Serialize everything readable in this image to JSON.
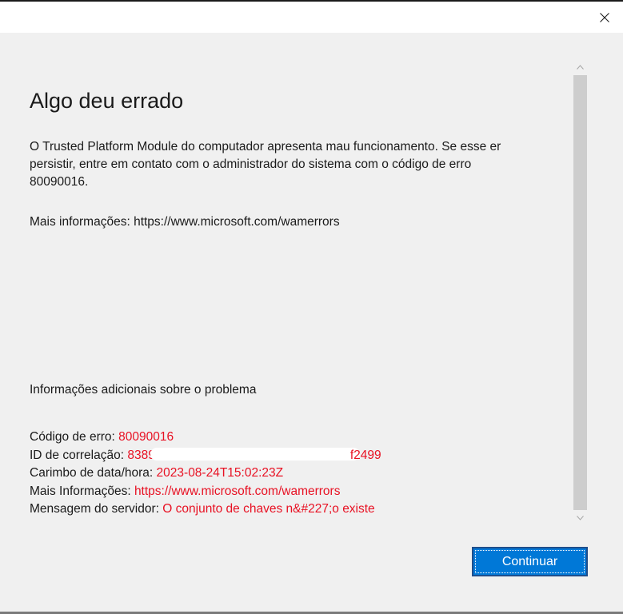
{
  "window": {
    "close_icon": "close-icon"
  },
  "error": {
    "heading": "Algo deu errado",
    "message_lines": [
      "O Trusted Platform Module do computador apresenta mau funcionamento. Se esse er",
      "persistir, entre em contato com o administrador do sistema com o código de erro",
      "80090016."
    ],
    "more_info": "Mais informações: https://www.microsoft.com/wamerrors"
  },
  "additional": {
    "title": "Informações adicionais sobre o problema",
    "rows": [
      {
        "label": "Código de erro: ",
        "value": "80090016"
      },
      {
        "label": "ID de correlação: ",
        "value_start": "8389",
        "value_end": "f2499"
      },
      {
        "label": "Carimbo de data/hora: ",
        "value": "2023-08-24T15:02:23Z"
      },
      {
        "label": "Mais Informações: ",
        "value": "https://www.microsoft.com/wamerrors"
      },
      {
        "label": "Mensagem do servidor: ",
        "value": "O conjunto de chaves n&#227;o existe"
      }
    ]
  },
  "buttons": {
    "continue_label": "Continuar"
  },
  "colors": {
    "accent": "#0078d7",
    "error_text": "#e81123",
    "background": "#f0f0f0"
  },
  "icons": {
    "close": "close-icon",
    "scroll_up": "chevron-up-icon",
    "scroll_down": "chevron-down-icon"
  }
}
